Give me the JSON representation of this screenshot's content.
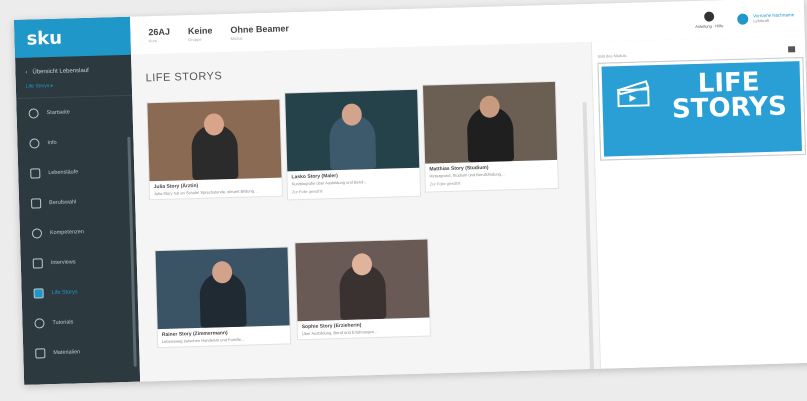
{
  "app": {
    "logo": "sku"
  },
  "sidebar": {
    "back_label": "Übersicht Lebenslauf",
    "subtitle": "Life Storys ▸",
    "items": [
      {
        "label": "Startseite",
        "icon": "clock-icon"
      },
      {
        "label": "Info",
        "icon": "info-icon"
      },
      {
        "label": "Lebensläufe",
        "icon": "people-icon"
      },
      {
        "label": "Berufswahl",
        "icon": "handshake-icon"
      },
      {
        "label": "Kompetenzen",
        "icon": "target-icon"
      },
      {
        "label": "Interviews",
        "icon": "chat-icon"
      },
      {
        "label": "Life Storys",
        "icon": "film-icon",
        "active": true
      },
      {
        "label": "Tutorials",
        "icon": "person-icon"
      },
      {
        "label": "Materialien",
        "icon": "download-icon"
      }
    ]
  },
  "header": {
    "groups": [
      {
        "value": "26AJ",
        "sub": "Kurs"
      },
      {
        "value": "Keine",
        "sub": "Gruppe"
      },
      {
        "value": "Ohne Beamer",
        "sub": "Modus"
      }
    ],
    "help_label": "Anleitung · Hilfe",
    "user_name": "Vorname Nachname",
    "user_role": "Lehrkraft"
  },
  "main": {
    "title": "LIFE STORYS",
    "cards": [
      {
        "title": "Julia Story (Ärztin)",
        "desc": "Julia Story hat an Schule/ Sprechstunde, steuert Bildung…",
        "footer": "",
        "bg": "#8a6a52",
        "skin": "#d8a58a",
        "shirt": "#2b2b2b"
      },
      {
        "title": "Lasko Story (Maler)",
        "desc": "Kurzbiografie über Ausbildung und Beruf…",
        "footer": "Zur Folie gewählt",
        "bg": "#25414a",
        "skin": "#d2a48b",
        "shirt": "#3d5a6d"
      },
      {
        "title": "Matthias Story (Studium)",
        "desc": "Hintergrund, Studium und Berufsfindung…",
        "footer": "Zur Folie gewählt",
        "bg": "#6b5e53",
        "skin": "#c89a80",
        "shirt": "#1f1f1f"
      },
      {
        "title": "Rainer Story (Zimmermann)",
        "desc": "Lebensweg zwischen Handwerk und Familie…",
        "footer": "",
        "bg": "#3a5466",
        "skin": "#d2a38a",
        "shirt": "#1f2a33"
      },
      {
        "title": "Sophie Story (Erzieherin)",
        "desc": "Über Ausbildung, Beruf und Erfahrungen…",
        "footer": "",
        "bg": "#6a5a55",
        "skin": "#e0b49c",
        "shirt": "#3a3230"
      }
    ]
  },
  "right": {
    "label": "Bild des Moduls",
    "banner_line1": "LIFE",
    "banner_line2": "STORYS",
    "banner_color": "#2a9fd6"
  }
}
